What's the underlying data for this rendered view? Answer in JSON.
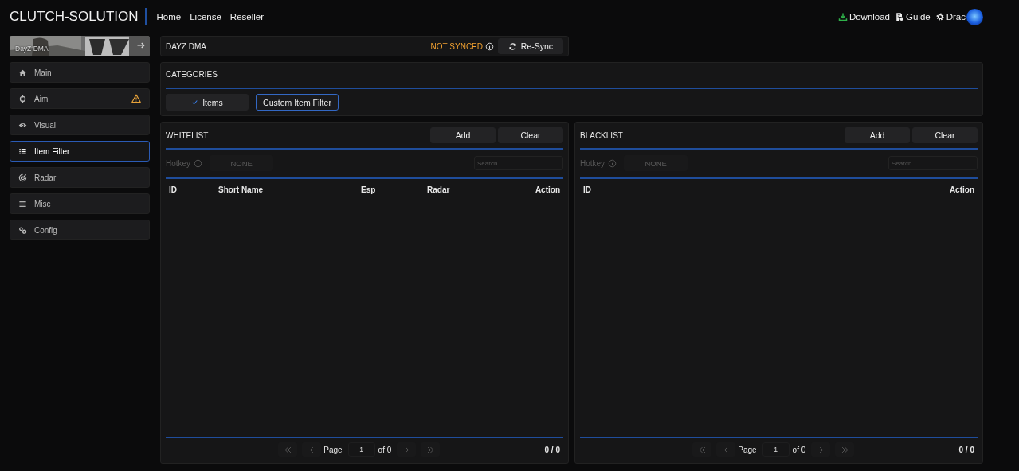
{
  "header": {
    "brand": "CLUTCH-SOLUTION",
    "nav": [
      {
        "label": "Home"
      },
      {
        "label": "License"
      },
      {
        "label": "Reseller"
      }
    ],
    "actions": [
      {
        "label": "Download"
      },
      {
        "label": "Guide"
      },
      {
        "label": "Drac"
      }
    ]
  },
  "sidebar": {
    "banner": {
      "label": "DayZ DMA",
      "kind": "picture"
    },
    "items": [
      {
        "label": "Main",
        "selected": false,
        "warning": false
      },
      {
        "label": "Aim",
        "selected": false,
        "warning": true
      },
      {
        "label": "Visual",
        "selected": false,
        "warning": false
      },
      {
        "label": "Item Filter",
        "selected": true,
        "warning": false
      },
      {
        "label": "Radar",
        "selected": false,
        "warning": false
      },
      {
        "label": "Misc",
        "selected": false,
        "warning": false
      },
      {
        "label": "Config",
        "selected": false,
        "warning": false
      }
    ]
  },
  "game_card": {
    "title": "DAYZ DMA",
    "status": "NOT SYNCED",
    "button": "Re-Sync"
  },
  "categories": {
    "title": "CATEGORIES",
    "tabs": [
      {
        "label": "Items",
        "checked": true,
        "selected": false
      },
      {
        "label": "Custom Item Filter",
        "checked": false,
        "selected": true
      }
    ]
  },
  "lists": [
    {
      "title": "WHITELIST",
      "buttons": [
        "Add",
        "Clear"
      ],
      "hotkey_label": "Hotkey",
      "hotkey_value": "NONE",
      "search": {
        "placeholder": "Search"
      },
      "columns": [
        "ID",
        "Short Name",
        "Esp",
        "Radar",
        "Action"
      ],
      "pagination": {
        "page_label": "Page",
        "page": "1",
        "of": "of 0",
        "count": "0 / 0"
      }
    },
    {
      "title": "BLACKLIST",
      "buttons": [
        "Add",
        "Clear"
      ],
      "hotkey_label": "Hotkey",
      "hotkey_value": "NONE",
      "search": {
        "placeholder": "Search"
      },
      "columns": [
        "ID",
        "Action"
      ],
      "pagination": {
        "page_label": "Page",
        "page": "1",
        "of": "of 0",
        "count": "0 / 0"
      }
    }
  ]
}
